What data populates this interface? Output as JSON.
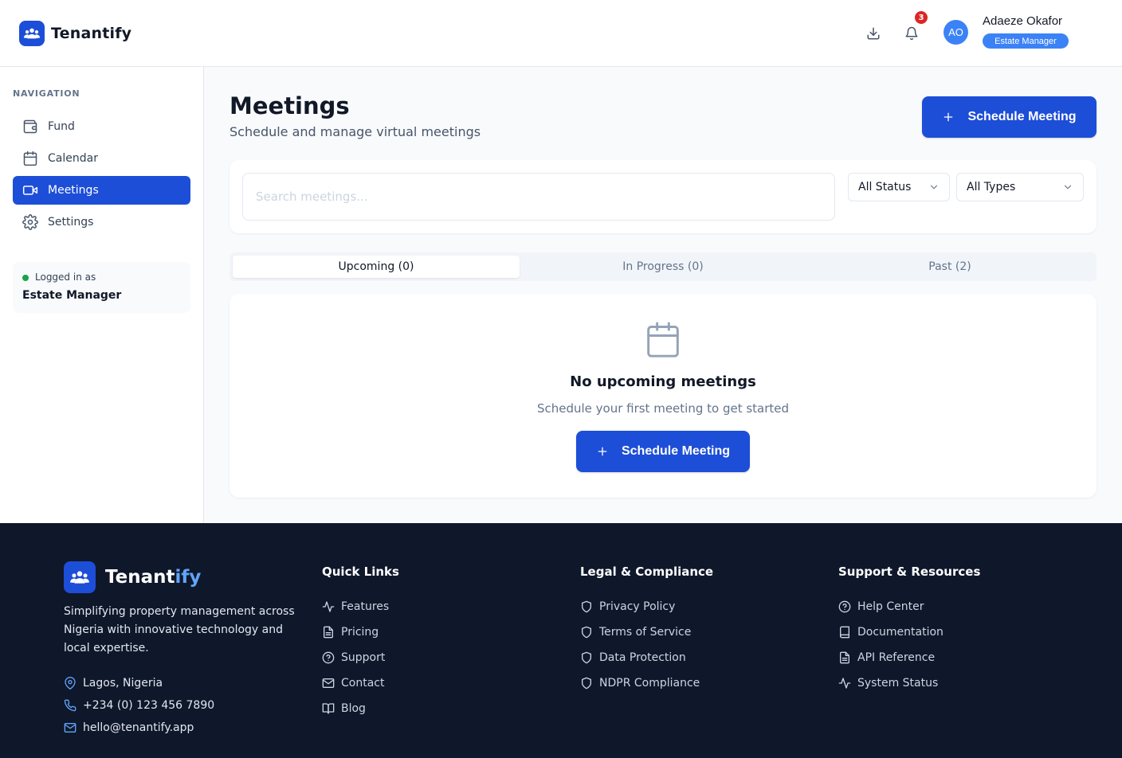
{
  "header": {
    "brand": "Tenantify",
    "notification_count": "3",
    "user": {
      "initials": "AO",
      "name": "Adaeze Okafor",
      "role": "Estate Manager"
    }
  },
  "sidebar": {
    "heading": "NAVIGATION",
    "items": [
      {
        "label": "Fund",
        "icon": "wallet-icon",
        "active": false
      },
      {
        "label": "Calendar",
        "icon": "calendar-icon",
        "active": false
      },
      {
        "label": "Meetings",
        "icon": "video-icon",
        "active": true
      },
      {
        "label": "Settings",
        "icon": "gear-icon",
        "active": false
      }
    ],
    "logged_in": {
      "label": "Logged in as",
      "role": "Estate Manager"
    }
  },
  "main": {
    "title": "Meetings",
    "subtitle": "Schedule and manage virtual meetings",
    "schedule_button": "Schedule Meeting",
    "search": {
      "placeholder": "Search meetings...",
      "value": ""
    },
    "filters": {
      "status": "All Status",
      "type": "All Types"
    },
    "tabs": [
      {
        "label": "Upcoming (0)",
        "active": true
      },
      {
        "label": "In Progress (0)",
        "active": false
      },
      {
        "label": "Past (2)",
        "active": false
      }
    ],
    "empty_state": {
      "title": "No upcoming meetings",
      "subtitle": "Schedule your first meeting to get started",
      "button": "Schedule Meeting"
    }
  },
  "footer": {
    "brand_prefix": "Tenant",
    "brand_suffix": "ify",
    "description": "Simplifying property management across Nigeria with innovative technology and local expertise.",
    "contacts": [
      {
        "icon": "map-pin-icon",
        "text": "Lagos, Nigeria"
      },
      {
        "icon": "phone-icon",
        "text": "+234 (0) 123 456 7890"
      },
      {
        "icon": "mail-icon",
        "text": "hello@tenantify.app"
      }
    ],
    "columns": [
      {
        "title": "Quick Links",
        "links": [
          {
            "label": "Features",
            "icon": "activity-icon"
          },
          {
            "label": "Pricing",
            "icon": "file-text-icon"
          },
          {
            "label": "Support",
            "icon": "help-circle-icon"
          },
          {
            "label": "Contact",
            "icon": "mail-icon"
          },
          {
            "label": "Blog",
            "icon": "book-open-icon"
          }
        ]
      },
      {
        "title": "Legal & Compliance",
        "links": [
          {
            "label": "Privacy Policy",
            "icon": "shield-icon"
          },
          {
            "label": "Terms of Service",
            "icon": "shield-icon"
          },
          {
            "label": "Data Protection",
            "icon": "shield-icon"
          },
          {
            "label": "NDPR Compliance",
            "icon": "shield-icon"
          }
        ]
      },
      {
        "title": "Support & Resources",
        "links": [
          {
            "label": "Help Center",
            "icon": "help-circle-icon"
          },
          {
            "label": "Documentation",
            "icon": "book-icon"
          },
          {
            "label": "API Reference",
            "icon": "file-text-icon"
          },
          {
            "label": "System Status",
            "icon": "activity-icon"
          }
        ]
      }
    ]
  },
  "colors": {
    "primary": "#1d4ed8",
    "accent": "#3b82f6",
    "footer_bg": "#0f172a",
    "notification": "#dc2626",
    "online": "#16a34a"
  }
}
